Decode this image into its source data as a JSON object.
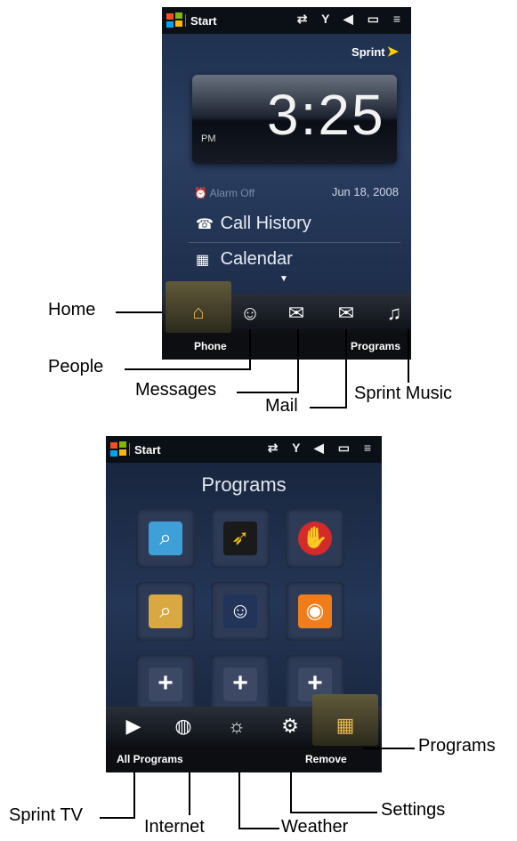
{
  "screen1": {
    "status_title": "Start",
    "status_icons": "⇄ Y ◀ ▭ ≡",
    "carrier": "Sprint",
    "clock_time": "3:25",
    "clock_ampm": "PM",
    "alarm": "Alarm Off",
    "date": "Jun 18, 2008",
    "items": [
      "Call History",
      "Calendar"
    ],
    "softkeys": {
      "left": "Phone",
      "right": "Programs"
    }
  },
  "screen2": {
    "status_title": "Start",
    "status_icons": "⇄ Y ◀ ▭ ≡",
    "title": "Programs",
    "softkeys": {
      "left": "All Programs",
      "right": "Remove"
    }
  },
  "callouts": {
    "home": "Home",
    "people": "People",
    "messages": "Messages",
    "mail": "Mail",
    "sprint_music": "Sprint Music",
    "programs": "Programs",
    "sprint_tv": "Sprint TV",
    "internet": "Internet",
    "weather": "Weather",
    "settings": "Settings"
  }
}
